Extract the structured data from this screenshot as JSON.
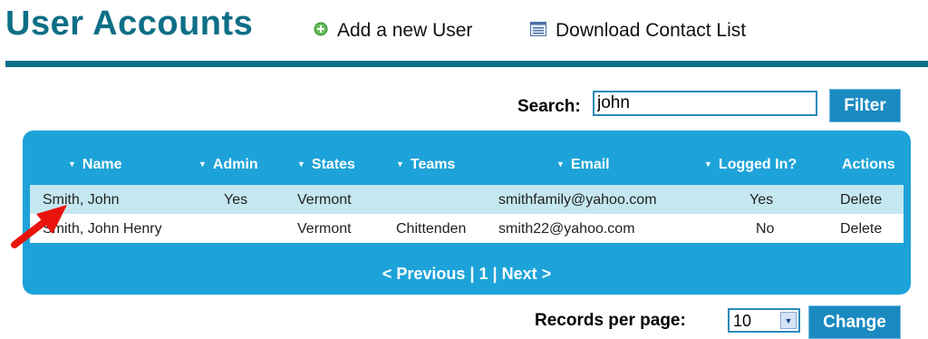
{
  "header": {
    "title": "User Accounts",
    "add_link": "Add a new User",
    "download_link": "Download Contact List"
  },
  "search": {
    "label": "Search:",
    "value": "john",
    "filter_button": "Filter"
  },
  "table": {
    "columns": [
      "Name",
      "Admin",
      "States",
      "Teams",
      "Email",
      "Logged In?",
      "Actions"
    ],
    "rows": [
      [
        "Smith, John",
        "Yes",
        "Vermont",
        "",
        "smithfamily@yahoo.com",
        "Yes",
        "Delete"
      ],
      [
        "Smith, John Henry",
        "",
        "Vermont",
        "Chittenden",
        "smith22@yahoo.com",
        "No",
        "Delete"
      ]
    ]
  },
  "pager": {
    "previous": "< Previous",
    "separator": "|",
    "page": "1",
    "next": "Next >"
  },
  "records_per_page": {
    "label": "Records per page:",
    "value": "10",
    "change_button": "Change"
  },
  "colors": {
    "title": "#0e6f86",
    "accent": "#1da3d9",
    "button": "#1b8ac1",
    "row_highlight": "#c5e7f0",
    "arrow": "#e8140c"
  },
  "icons": {
    "add": "plus-circle-icon",
    "download": "list-document-icon",
    "sort": "sort-arrow-icon",
    "dropdown": "chevron-down-icon",
    "pointer": "red-arrow-icon"
  }
}
